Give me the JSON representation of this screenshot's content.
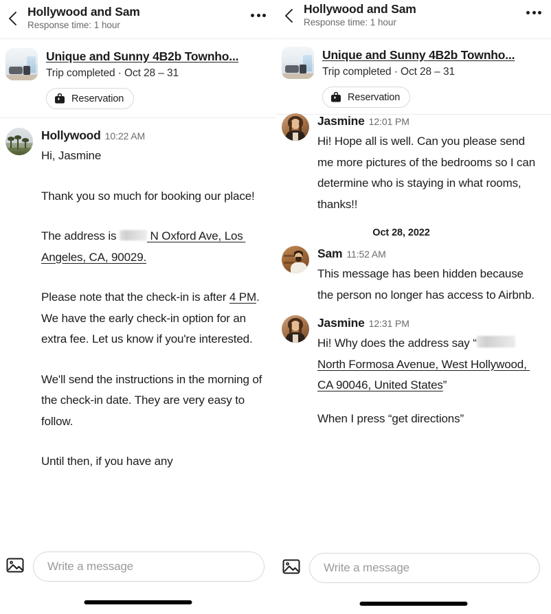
{
  "panels": [
    {
      "header": {
        "title": "Hollywood and Sam",
        "subtitle": "Response time: 1 hour",
        "back_icon": "chevron-left-icon",
        "more_icon": "more-options-icon"
      },
      "listing": {
        "title": "Unique and Sunny 4B2b Townho...",
        "status": "Trip completed · Oct 28 – 31",
        "reservation_label": "Reservation",
        "reservation_icon": "briefcase-icon",
        "thumbnail": "living-room-photo"
      },
      "messages": [
        {
          "sender": "Hollywood",
          "time": "10:22 AM",
          "avatar": "hollywood-palm-trees-avatar",
          "paragraphs": [
            "Hi, Jasmine",
            "Thank you so much for booking our place!",
            "The address is [redacted] N Oxford Ave, Los Angeles, CA, 90029.",
            "Please note that the check-in is after 4 PM. We have the early check-in option for an extra fee. Let us know if you're interested.",
            "We'll send the instructions in the morning of the check-in date. They are very easy to follow.",
            "Until then, if you have any"
          ]
        }
      ],
      "composer": {
        "placeholder": "Write a message",
        "value": "",
        "image_icon": "image-attachment-icon"
      }
    },
    {
      "header": {
        "title": "Hollywood and Sam",
        "subtitle": "Response time: 1 hour",
        "back_icon": "chevron-left-icon",
        "more_icon": "more-options-icon"
      },
      "listing": {
        "title": "Unique and Sunny 4B2b Townho...",
        "status": "Trip completed · Oct 28 – 31",
        "reservation_label": "Reservation",
        "reservation_icon": "briefcase-icon",
        "thumbnail": "living-room-photo"
      },
      "messages": [
        {
          "sender": "Jasmine",
          "time": "12:01 PM",
          "avatar": "jasmine-portrait-avatar",
          "text": "Hi! Hope all is well. Can you please send me more pictures of the bedrooms so I can determine who is staying in what rooms, thanks!!"
        },
        {
          "date_separator": "Oct 28, 2022"
        },
        {
          "sender": "Sam",
          "time": "11:52 AM",
          "avatar": "sam-portrait-avatar",
          "text": "This message has been hidden because the person no longer has access to Airbnb."
        },
        {
          "sender": "Jasmine",
          "time": "12:31 PM",
          "avatar": "jasmine-portrait-avatar",
          "line1_prefix": "Hi! Why does the address say “",
          "address_redacted": "[redacted]",
          "address": "North Formosa Avenue, West Hollywood, CA 90046, United States",
          "line1_suffix": "”",
          "line2": "When I press “get directions”"
        }
      ],
      "composer": {
        "placeholder": "Write a message",
        "value": "",
        "image_icon": "image-attachment-icon"
      }
    }
  ]
}
